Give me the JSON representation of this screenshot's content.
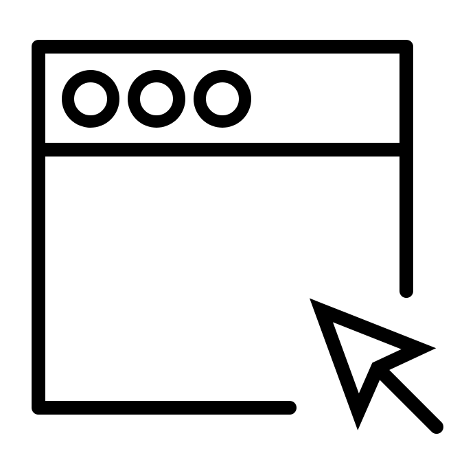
{
  "icon": {
    "name": "browser-window-cursor-icon",
    "stroke_color": "#000000",
    "background_color": "#ffffff"
  },
  "parts": [
    "window-frame",
    "title-bar",
    "window-control-dots",
    "mouse-pointer-cursor"
  ]
}
